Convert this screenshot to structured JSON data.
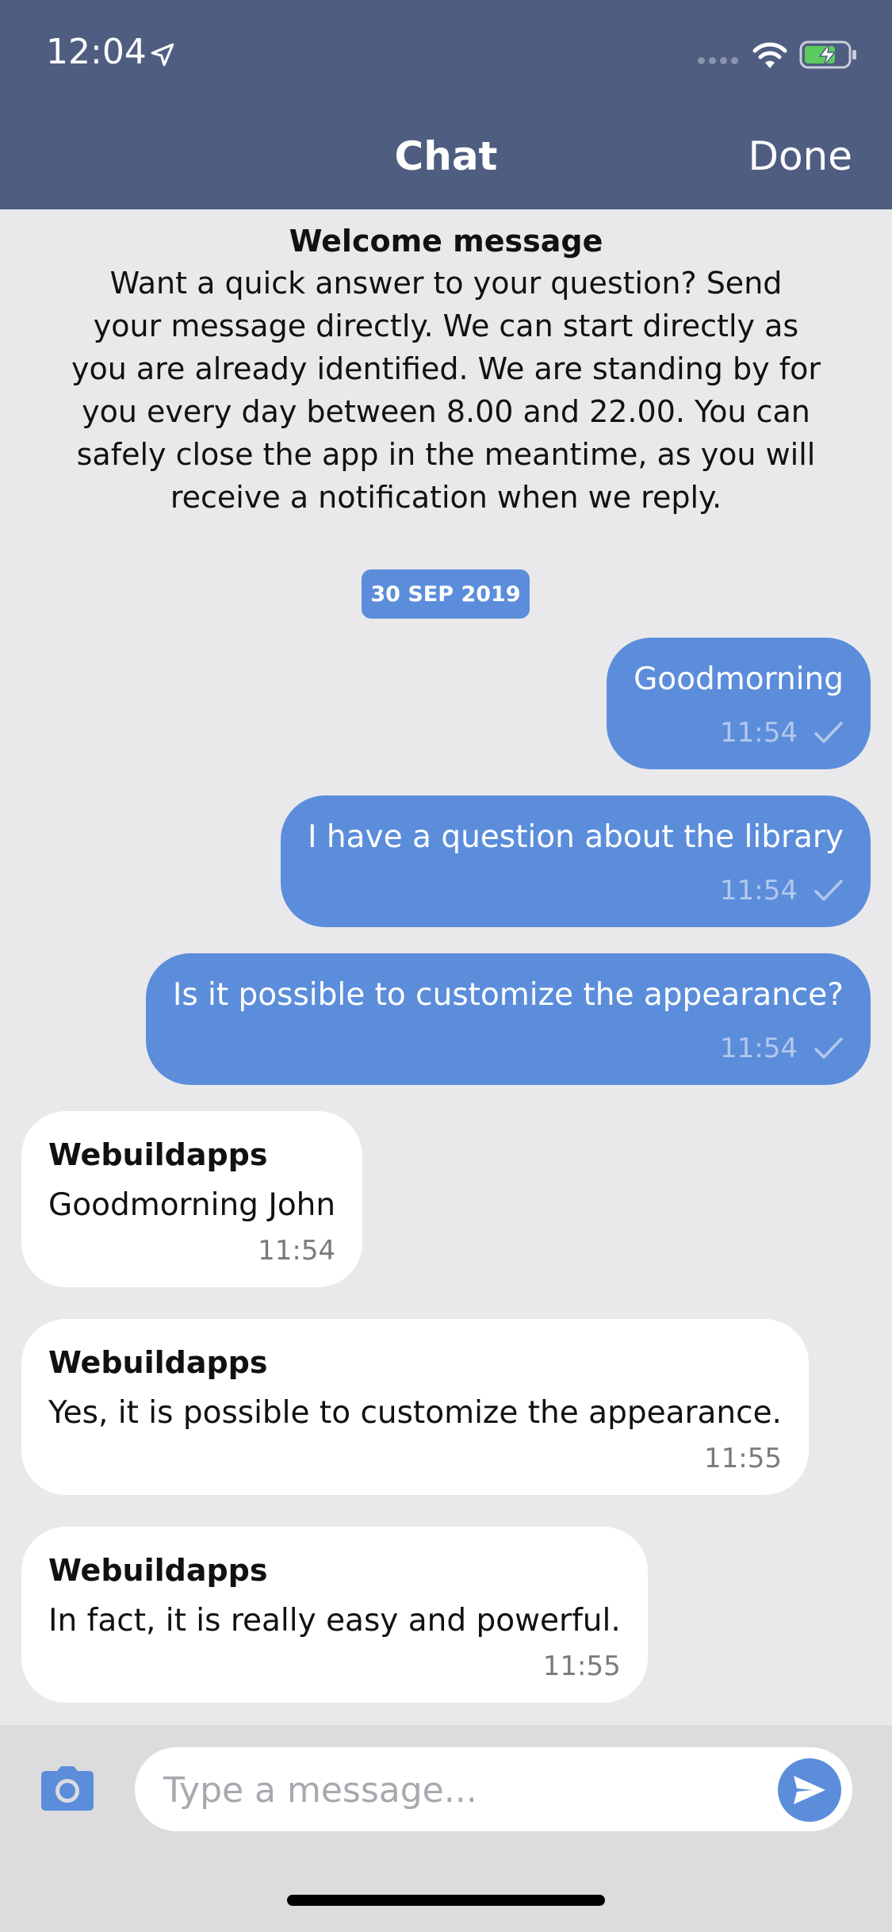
{
  "status_bar": {
    "time": "12:04",
    "icons": [
      "location-arrow-icon",
      "signal-dots-icon",
      "wifi-icon",
      "battery-charging-icon"
    ]
  },
  "nav": {
    "title": "Chat",
    "done_label": "Done"
  },
  "welcome": {
    "title": "Welcome message",
    "body": "Want a quick answer to your question? Send your message directly. We can start directly as you are already identified. We are standing by for you every day between 8.00  and 22.00. You can safely close the app in the meantime, as you will receive a notification when we reply."
  },
  "date_badge": "30 SEP 2019",
  "messages": [
    {
      "direction": "out",
      "text": "Goodmorning",
      "time": "11:54",
      "status": "sent"
    },
    {
      "direction": "out",
      "text": "I have a question about the library",
      "time": "11:54",
      "status": "sent"
    },
    {
      "direction": "out",
      "text": "Is it possible to customize the appearance?",
      "time": "11:54",
      "status": "sent"
    },
    {
      "direction": "in",
      "sender": "Webuildapps",
      "text": "Goodmorning John",
      "time": "11:54"
    },
    {
      "direction": "in",
      "sender": "Webuildapps",
      "text": "Yes, it is possible to customize the appearance.",
      "time": "11:55"
    },
    {
      "direction": "in",
      "sender": "Webuildapps",
      "text": "In fact, it is really easy and powerful.",
      "time": "11:55"
    }
  ],
  "composer": {
    "placeholder": "Type a message...",
    "value": ""
  },
  "colors": {
    "header": "#4f5d80",
    "accent": "#5b8ddb",
    "background": "#e9e9eb",
    "incoming_bubble": "#ffffff"
  }
}
